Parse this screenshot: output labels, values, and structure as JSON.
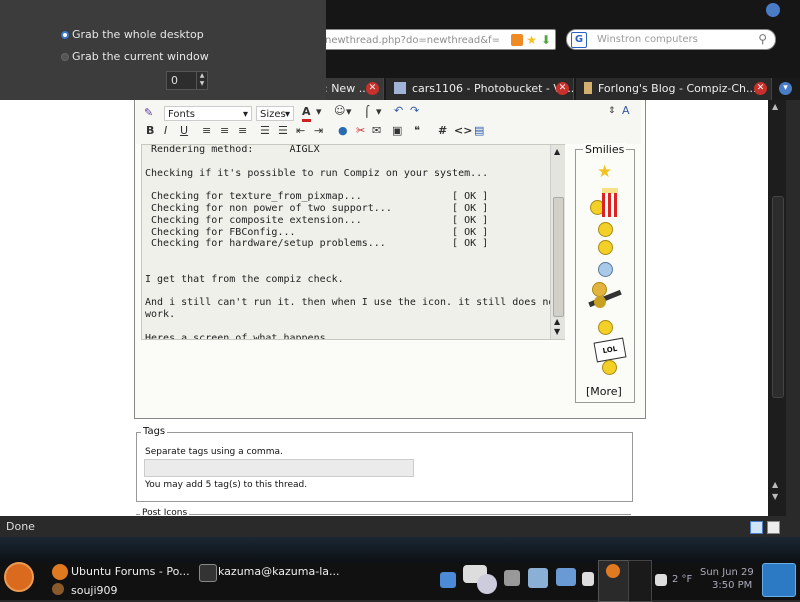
{
  "screenshot_popup": {
    "options": [
      "Grab the whole desktop",
      "Grab the current window"
    ],
    "selected_option": "Grab the whole desktop",
    "delay_value": "0"
  },
  "browser": {
    "url_value": "newthread.php?do=newthread&f=",
    "search_placeholder": "Winstron computers",
    "tabs": [
      {
        "label": ": New ..."
      },
      {
        "label": "cars1106 - Photobucket - Vi..."
      },
      {
        "label": "Forlong's Blog - Compiz-Ch..."
      }
    ],
    "status_text": "Done"
  },
  "editor": {
    "font_select": "Fonts",
    "size_select": "Sizes",
    "text_lines": [
      " Rendering method:      AIGLX",
      "",
      "Checking if it's possible to run Compiz on your system...",
      "",
      " Checking for texture_from_pixmap...               [ OK ]",
      " Checking for non power of two support...          [ OK ]",
      " Checking for composite extension...               [ OK ]",
      " Checking for FBConfig...                          [ OK ]",
      " Checking for hardware/setup problems...           [ OK ]",
      "",
      "",
      "I get that from the compiz check.",
      "",
      "And i still can't run it. then when I use the icon. it still does not",
      "work.",
      "",
      "Heres a screen of what happens"
    ]
  },
  "smilies": {
    "title": "Smilies",
    "more_label": "[More]",
    "items": [
      "star-icon",
      "popcorn-icon",
      "smile-icon",
      "confused-icon",
      "question-icon",
      "guitar-icon",
      "sad-icon",
      "lol-sign-icon"
    ]
  },
  "tags": {
    "legend": "Tags",
    "instruction": "Separate tags using a comma.",
    "limit_note": "You may add 5 tag(s) to this thread."
  },
  "post_icons": {
    "legend": "Post Icons"
  },
  "taskbar": {
    "tasks": [
      {
        "label": "Ubuntu Forums - Po..."
      },
      {
        "label": "kazuma@kazuma-la..."
      },
      {
        "label": "souji909"
      }
    ],
    "temperature": "2 °F",
    "date": "Sun Jun 29",
    "time": "3:50 PM"
  }
}
